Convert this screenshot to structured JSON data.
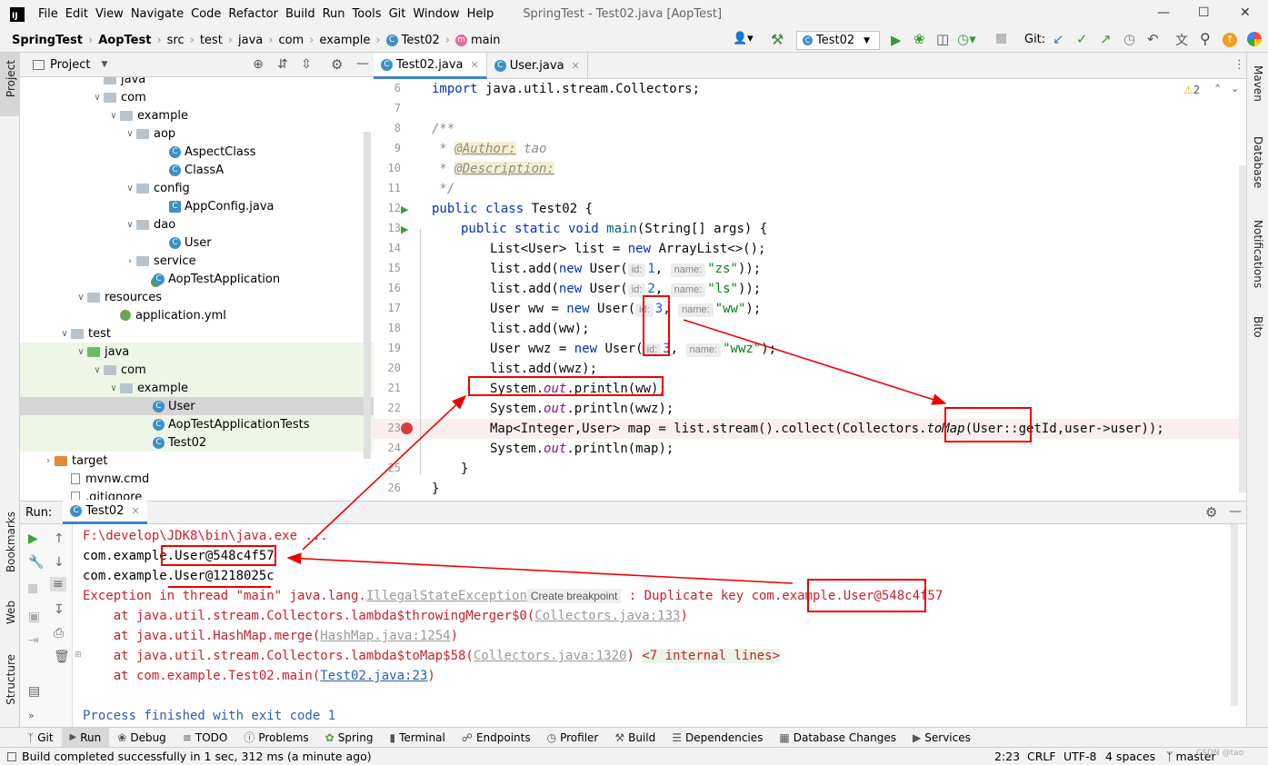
{
  "app": {
    "icon_label": "IJ",
    "menu": [
      "File",
      "Edit",
      "View",
      "Navigate",
      "Code",
      "Refactor",
      "Build",
      "Run",
      "Tools",
      "Git",
      "Window",
      "Help"
    ],
    "window_title": "SpringTest - Test02.java [AopTest]"
  },
  "breadcrumb": [
    "SpringTest",
    "AopTest",
    "src",
    "test",
    "java",
    "com",
    "example",
    "Test02",
    "main"
  ],
  "toolbar": {
    "run_config": "Test02",
    "git_label": "Git:"
  },
  "project_panel": {
    "title": "Project",
    "tree": [
      {
        "label": "java",
        "indent": 5,
        "type": "folder"
      },
      {
        "label": "com",
        "indent": 5,
        "type": "folder",
        "open": true
      },
      {
        "label": "example",
        "indent": 6,
        "type": "folder",
        "open": true
      },
      {
        "label": "aop",
        "indent": 7,
        "type": "folder",
        "open": true
      },
      {
        "label": "AspectClass",
        "indent": 9,
        "type": "class"
      },
      {
        "label": "ClassA",
        "indent": 9,
        "type": "class"
      },
      {
        "label": "config",
        "indent": 7,
        "type": "folder",
        "open": true
      },
      {
        "label": "AppConfig.java",
        "indent": 9,
        "type": "java"
      },
      {
        "label": "dao",
        "indent": 7,
        "type": "folder",
        "open": true
      },
      {
        "label": "User",
        "indent": 9,
        "type": "class"
      },
      {
        "label": "service",
        "indent": 7,
        "type": "folder",
        "open": false
      },
      {
        "label": "AopTestApplication",
        "indent": 8,
        "type": "spring"
      },
      {
        "label": "resources",
        "indent": 4,
        "type": "res",
        "open": true
      },
      {
        "label": "application.yml",
        "indent": 6,
        "type": "yml"
      },
      {
        "label": "test",
        "indent": 3,
        "type": "folder",
        "open": true
      },
      {
        "label": "java",
        "indent": 4,
        "type": "green",
        "open": true
      },
      {
        "label": "com",
        "indent": 5,
        "type": "folder",
        "open": true
      },
      {
        "label": "example",
        "indent": 6,
        "type": "folder",
        "open": true
      },
      {
        "label": "User",
        "indent": 8,
        "type": "class",
        "selected": true
      },
      {
        "label": "AopTestApplicationTests",
        "indent": 8,
        "type": "class"
      },
      {
        "label": "Test02",
        "indent": 8,
        "type": "class"
      },
      {
        "label": "target",
        "indent": 2,
        "type": "orange",
        "open": false
      },
      {
        "label": "mvnw.cmd",
        "indent": 3,
        "type": "file"
      },
      {
        "label": ".gitignore",
        "indent": 3,
        "type": "file"
      }
    ]
  },
  "editor": {
    "tabs": [
      "Test02.java",
      "User.java"
    ],
    "warning_count": "2",
    "line_numbers": [
      "6",
      "7",
      "8",
      "9",
      "10",
      "11",
      "12",
      "13",
      "14",
      "15",
      "16",
      "17",
      "18",
      "19",
      "20",
      "21",
      "22",
      "23",
      "24",
      "25",
      "26"
    ],
    "code": {
      "l6_kw": "import",
      "l6_rest": " java.util.stream.Collectors;",
      "l8": "/**",
      "l9_pre": " * ",
      "l9_tag": "@Author:",
      "l9_val": " tao",
      "l10_pre": " * ",
      "l10_tag": "@Description:",
      "l11": " */",
      "l12_kw": "public class",
      "l12_rest": " Test02 {",
      "l13_kw": "public static void",
      "l13_name": " main",
      "l13_rest": "(String[] args) {",
      "l14_a": "List<User> list = ",
      "l14_kw": "new",
      "l14_b": " ArrayList<>();",
      "l15_a": "list.add(",
      "l15_kw": "new",
      "l15_b": " User(",
      "l15_h1": "id:",
      "l15_n": "1",
      "l15_c": ", ",
      "l15_h2": "name:",
      "l15_s": "\"zs\"",
      "l15_d": "));",
      "l16_a": "list.add(",
      "l16_kw": "new",
      "l16_b": " User(",
      "l16_h1": "id:",
      "l16_n": "2",
      "l16_c": ", ",
      "l16_h2": "name:",
      "l16_s": "\"ls\"",
      "l16_d": "));",
      "l17_a": "User ww = ",
      "l17_kw": "new",
      "l17_b": " User(",
      "l17_h1": "id:",
      "l17_n": "3",
      "l17_c": ", ",
      "l17_h2": "name:",
      "l17_s": "\"ww\"",
      "l17_d": ");",
      "l18": "list.add(ww);",
      "l19_a": "User wwz = ",
      "l19_kw": "new",
      "l19_b": " User(",
      "l19_h1": "id:",
      "l19_n": "3",
      "l19_c": ", ",
      "l19_h2": "name:",
      "l19_s": "\"wwz\"",
      "l19_d": ");",
      "l20": "list.add(wwz);",
      "l21_a": "System.",
      "l21_f": "out",
      "l21_b": ".println(ww);",
      "l22_a": "System.",
      "l22_f": "out",
      "l22_b": ".println(wwz);",
      "l23_a": "Map<Integer,User> map = list.stream().collect(Collectors.",
      "l23_i": "toMap",
      "l23_b": "(User::getId,user->user));",
      "l24_a": "System.",
      "l24_f": "out",
      "l24_b": ".println(map);",
      "l25": "}",
      "l26": "}"
    }
  },
  "run_panel": {
    "label": "Run:",
    "tab": "Test02",
    "console": {
      "c1": "F:\\develop\\JDK8\\bin\\java.exe ...",
      "c2": "com.example.User@548c4f57",
      "c3": "com.example.User@1218025c",
      "c4_a": "Exception in thread \"main\" java.lang.",
      "c4_link": "IllegalStateException",
      "c4_bp": "Create breakpoint",
      "c4_b": " : Duplicate key com.example.User@548c4f57",
      "c5_a": "    at java.util.stream.Collectors.lambda$throwingMerger$0(",
      "c5_link": "Collectors.java:133",
      "c5_b": ")",
      "c6_a": "    at java.util.HashMap.merge(",
      "c6_link": "HashMap.java:1254",
      "c6_b": ")",
      "c7_a": "    at java.util.stream.Collectors.lambda$toMap$58(",
      "c7_link": "Collectors.java:1320",
      "c7_b": ") ",
      "c7_internal": "<7 internal lines>",
      "c8_a": "    at com.example.Test02.main(",
      "c8_link": "Test02.java:23",
      "c8_b": ")",
      "c10": "Process finished with exit code 1"
    }
  },
  "left_strip": {
    "project": "Project",
    "bookmarks": "Bookmarks",
    "web": "Web",
    "structure": "Structure"
  },
  "right_strip": {
    "maven": "Maven",
    "database": "Database",
    "notifications": "Notifications",
    "bito": "Bito"
  },
  "bottom_tools": [
    "Git",
    "Run",
    "Debug",
    "TODO",
    "Problems",
    "Spring",
    "Terminal",
    "Endpoints",
    "Profiler",
    "Build",
    "Dependencies",
    "Database Changes",
    "Services"
  ],
  "status": {
    "message": "Build completed successfully in 1 sec, 312 ms (a minute ago)",
    "position": "2:23",
    "line_sep": "CRLF",
    "encoding": "UTF-8",
    "indent": "4 spaces",
    "branch": "master",
    "watermark": "CSDN @tao"
  },
  "colors": {
    "annotation": "#e00000",
    "breakpoint": "#db3b3b",
    "accent": "#4083c9"
  }
}
